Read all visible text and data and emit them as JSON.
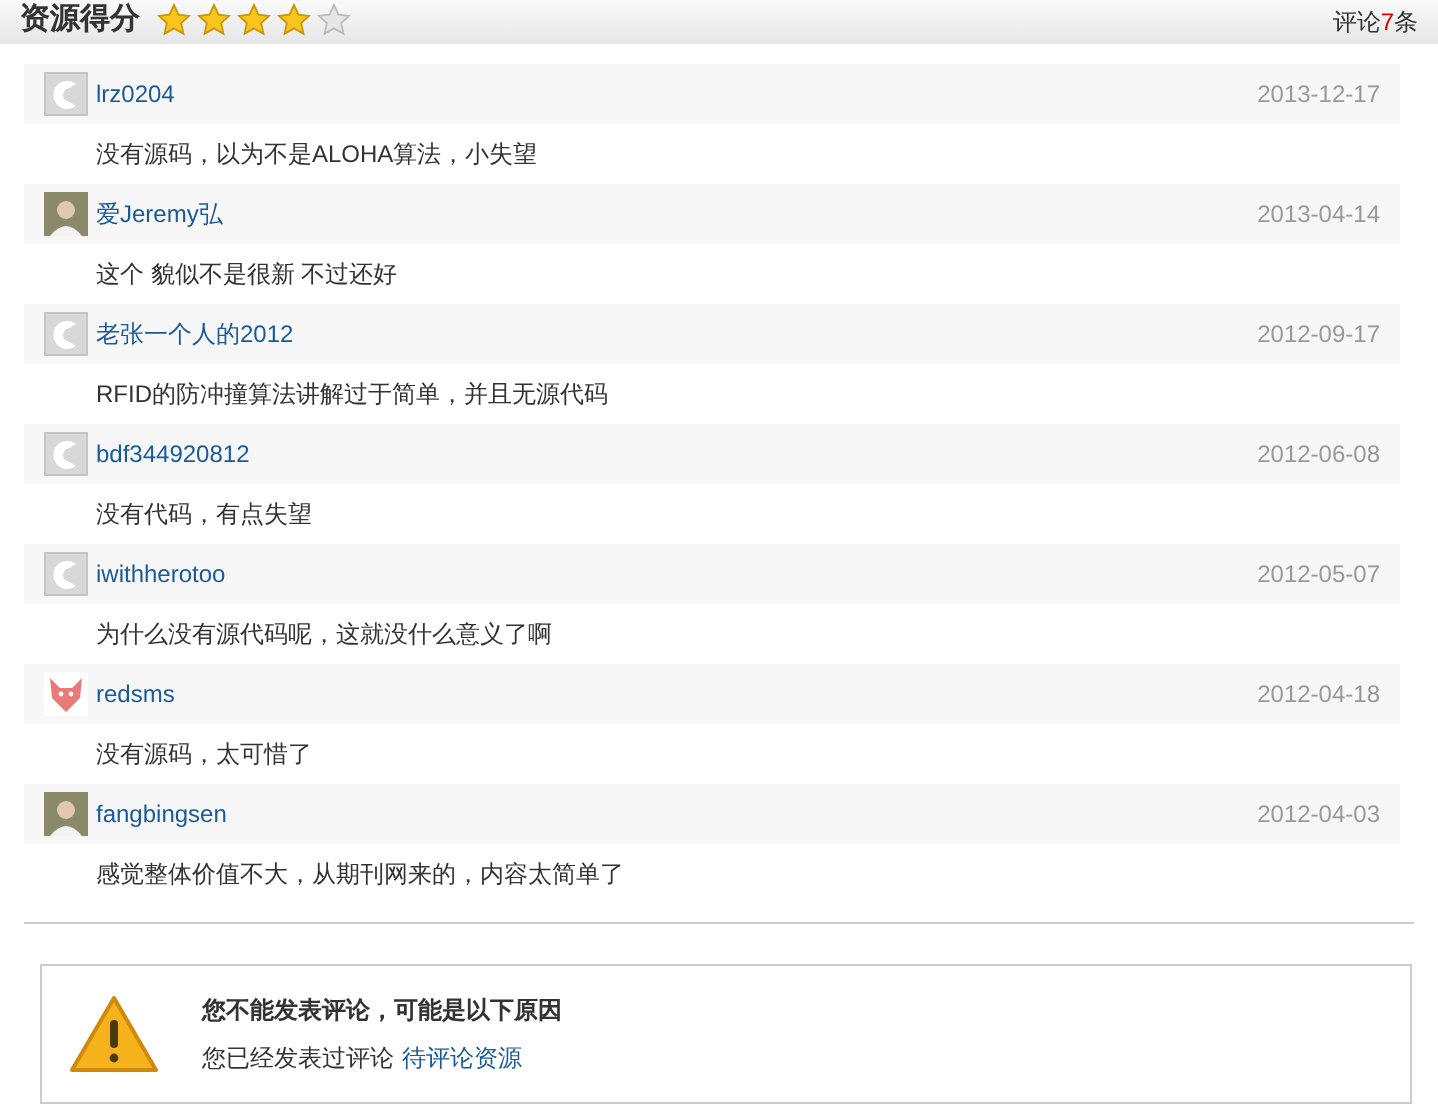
{
  "header": {
    "title": "资源得分",
    "stars": 4,
    "count_prefix": "评论",
    "count": "7",
    "count_suffix": "条"
  },
  "comments": [
    {
      "user": "lrz0204",
      "kind": "default",
      "date": "2013-12-17",
      "text": "没有源码，以为不是ALOHA算法，小失望"
    },
    {
      "user": "爱Jeremy弘",
      "kind": "photo",
      "date": "2013-04-14",
      "text": "这个 貌似不是很新 不过还好"
    },
    {
      "user": "老张一个人的2012",
      "kind": "default",
      "date": "2012-09-17",
      "text": "RFID的防冲撞算法讲解过于简单，并且无源代码"
    },
    {
      "user": "bdf344920812",
      "kind": "default",
      "date": "2012-06-08",
      "text": "没有代码，有点失望"
    },
    {
      "user": "iwithherotoo",
      "kind": "default",
      "date": "2012-05-07",
      "text": "为什么没有源代码呢，这就没什么意义了啊"
    },
    {
      "user": "redsms",
      "kind": "cartoon",
      "date": "2012-04-18",
      "text": "没有源码，太可惜了"
    },
    {
      "user": "fangbingsen",
      "kind": "photo",
      "date": "2012-04-03",
      "text": "感觉整体价值不大，从期刊网来的，内容太简单了"
    }
  ],
  "notice": {
    "title": "您不能发表评论，可能是以下原因",
    "reason": "您已经发表过评论",
    "link": "待评论资源"
  }
}
